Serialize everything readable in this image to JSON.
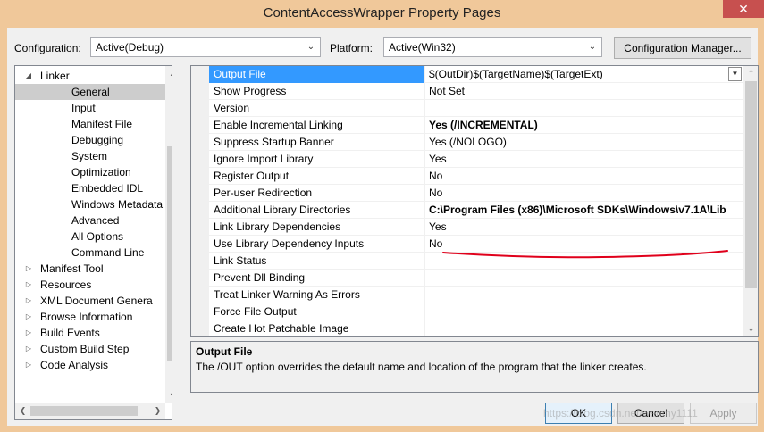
{
  "window": {
    "title": "ContentAccessWrapper Property Pages",
    "close_glyph": "✕"
  },
  "config": {
    "configuration_label": "Configuration:",
    "configuration_value": "Active(Debug)",
    "platform_label": "Platform:",
    "platform_value": "Active(Win32)",
    "manager_button": "Configuration Manager..."
  },
  "tree": {
    "items": [
      {
        "label": "Linker",
        "expander": "◢",
        "level": 1
      },
      {
        "label": "General",
        "level": 2,
        "selected": true
      },
      {
        "label": "Input",
        "level": 2
      },
      {
        "label": "Manifest File",
        "level": 2
      },
      {
        "label": "Debugging",
        "level": 2
      },
      {
        "label": "System",
        "level": 2
      },
      {
        "label": "Optimization",
        "level": 2
      },
      {
        "label": "Embedded IDL",
        "level": 2
      },
      {
        "label": "Windows Metadata",
        "level": 2
      },
      {
        "label": "Advanced",
        "level": 2
      },
      {
        "label": "All Options",
        "level": 2
      },
      {
        "label": "Command Line",
        "level": 2
      },
      {
        "label": "Manifest Tool",
        "expander": "▷",
        "level": 1
      },
      {
        "label": "Resources",
        "expander": "▷",
        "level": 1
      },
      {
        "label": "XML Document Genera",
        "expander": "▷",
        "level": 1
      },
      {
        "label": "Browse Information",
        "expander": "▷",
        "level": 1
      },
      {
        "label": "Build Events",
        "expander": "▷",
        "level": 1
      },
      {
        "label": "Custom Build Step",
        "expander": "▷",
        "level": 1
      },
      {
        "label": "Code Analysis",
        "expander": "▷",
        "level": 1
      }
    ]
  },
  "grid": {
    "rows": [
      {
        "name": "Output File",
        "value": "$(OutDir)$(TargetName)$(TargetExt)",
        "selected": true,
        "dropdown": true
      },
      {
        "name": "Show Progress",
        "value": "Not Set"
      },
      {
        "name": "Version",
        "value": ""
      },
      {
        "name": "Enable Incremental Linking",
        "value": "Yes (/INCREMENTAL)",
        "bold": true
      },
      {
        "name": "Suppress Startup Banner",
        "value": "Yes (/NOLOGO)"
      },
      {
        "name": "Ignore Import Library",
        "value": "Yes"
      },
      {
        "name": "Register Output",
        "value": "No"
      },
      {
        "name": "Per-user Redirection",
        "value": "No"
      },
      {
        "name": "Additional Library Directories",
        "value": "C:\\Program Files (x86)\\Microsoft SDKs\\Windows\\v7.1A\\Lib",
        "bold": true
      },
      {
        "name": "Link Library Dependencies",
        "value": "Yes"
      },
      {
        "name": "Use Library Dependency Inputs",
        "value": "No"
      },
      {
        "name": "Link Status",
        "value": ""
      },
      {
        "name": "Prevent Dll Binding",
        "value": ""
      },
      {
        "name": "Treat Linker Warning As Errors",
        "value": ""
      },
      {
        "name": "Force File Output",
        "value": ""
      },
      {
        "name": "Create Hot Patchable Image",
        "value": ""
      }
    ]
  },
  "description": {
    "title": "Output File",
    "text": "The /OUT option overrides the default name and location of the program that the linker creates."
  },
  "buttons": {
    "ok": "OK",
    "cancel": "Cancel",
    "apply": "Apply"
  },
  "watermark": "https://blog.csdn.net/wenmy1111",
  "colors": {
    "selection": "#3399ff",
    "annotation_underline": "#e0001b"
  }
}
